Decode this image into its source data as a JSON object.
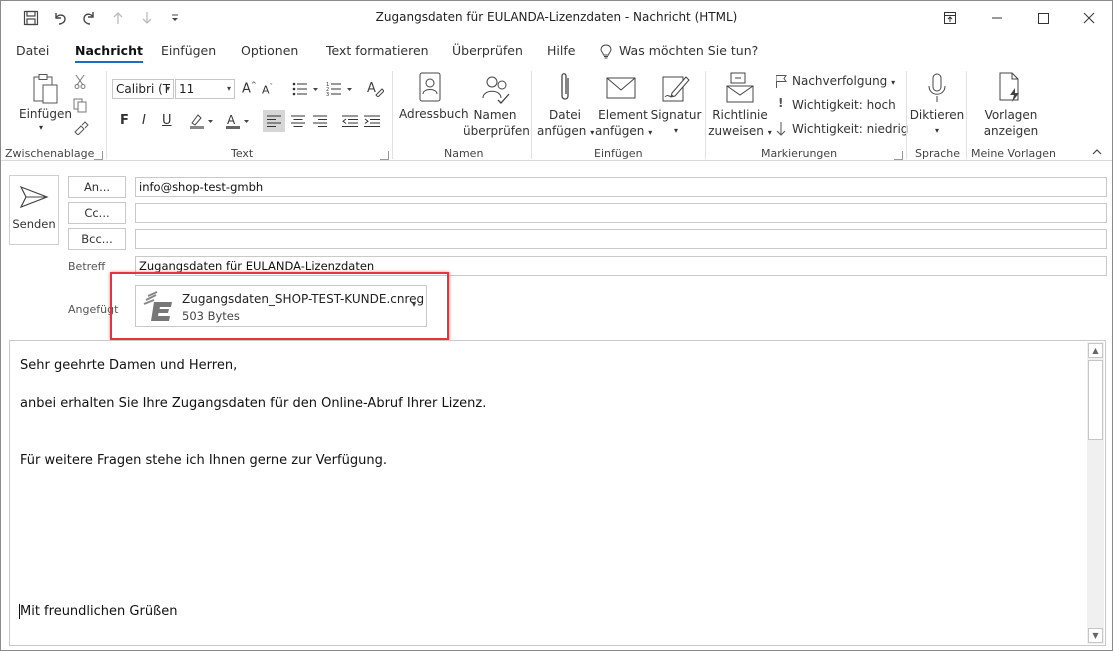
{
  "window": {
    "title": "Zugangsdaten für EULANDA-Lizenzdaten  -  Nachricht (HTML)"
  },
  "ribbon_tabs": [
    {
      "label": "Datei",
      "active": false
    },
    {
      "label": "Nachricht",
      "active": true
    },
    {
      "label": "Einfügen",
      "active": false
    },
    {
      "label": "Optionen",
      "active": false
    },
    {
      "label": "Text formatieren",
      "active": false
    },
    {
      "label": "Überprüfen",
      "active": false
    },
    {
      "label": "Hilfe",
      "active": false
    }
  ],
  "tell_me": "Was möchten Sie tun?",
  "ribbon": {
    "clipboard": {
      "paste_label": "Einfügen",
      "group_label": "Zwischenablage"
    },
    "text": {
      "font_name": "Calibri (T",
      "font_size": "11",
      "bold": "F",
      "italic": "I",
      "underline": "U",
      "group_label": "Text"
    },
    "names": {
      "address_book": "Adressbuch",
      "check_names_1": "Namen",
      "check_names_2": "überprüfen",
      "group_label": "Namen"
    },
    "include": {
      "attach_file_1": "Datei",
      "attach_file_2": "anfügen",
      "attach_item_1": "Element",
      "attach_item_2": "anfügen",
      "signature": "Signatur",
      "group_label": "Einfügen"
    },
    "tags": {
      "policy_1": "Richtlinie",
      "policy_2": "zuweisen",
      "follow_up": "Nachverfolgung",
      "importance_high": "Wichtigkeit: hoch",
      "importance_low": "Wichtigkeit: niedrig",
      "group_label": "Markierungen"
    },
    "voice": {
      "dictate": "Diktieren",
      "group_label": "Sprache"
    },
    "templates": {
      "view_1": "Vorlagen",
      "view_2": "anzeigen",
      "group_label": "Meine Vorlagen"
    }
  },
  "compose": {
    "send_label": "Senden",
    "to_button": "An...",
    "cc_button": "Cc...",
    "bcc_button": "Bcc...",
    "to_value": "info@shop-test-gmbh",
    "cc_value": "",
    "bcc_value": "",
    "subject_label": "Betreff",
    "subject_value": "Zugangsdaten für EULANDA-Lizenzdaten",
    "attached_label": "Angefügt",
    "attachment": {
      "name": "Zugangsdaten_SHOP-TEST-KUNDE.cnreg",
      "size": "503 Bytes"
    }
  },
  "body": {
    "lines": [
      "Sehr geehrte Damen und Herren,",
      "anbei erhalten Sie Ihre Zugangsdaten für den Online-Abruf Ihrer Lizenz.",
      "Für weitere Fragen stehe ich Ihnen gerne zur Verfügung.",
      "Mit freundlichen Grüßen"
    ]
  },
  "colors": {
    "accent": "#1a6fc4",
    "highlight": "#e5353a"
  }
}
